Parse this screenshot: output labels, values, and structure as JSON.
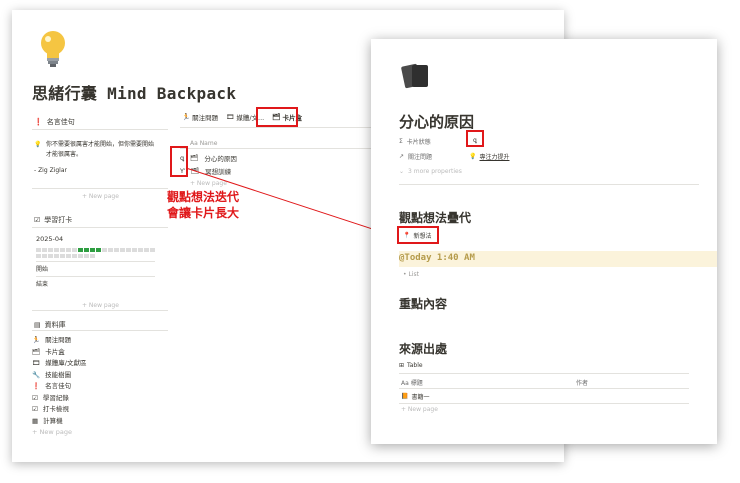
{
  "back_page": {
    "icon": "light-bulb-icon",
    "title": "思緒行囊 Mind Backpack",
    "quote_section": {
      "icon": "exclamation-icon",
      "label": "名言佳句"
    },
    "quote_text": "你不需要很厲害才能開始，但你需要開始才能很厲害。",
    "quote_author": "- Zig Ziglar",
    "new_page_1": "+ New page",
    "checkin_section": {
      "icon": "checkbox-icon",
      "label": "學習打卡"
    },
    "calendar_month": "2025-04",
    "start_label": "開始",
    "end_label": "結束",
    "new_page_2": "+ New page",
    "database_section": {
      "icon": "database-icon",
      "label": "資料庫"
    },
    "sidebar_items": [
      {
        "icon": "running-icon",
        "label": "關注問題"
      },
      {
        "icon": "cards-icon",
        "label": "卡片盒"
      },
      {
        "icon": "film-icon",
        "label": "媒體庫/文獻區"
      },
      {
        "icon": "wrench-icon",
        "label": "技能樹圖"
      },
      {
        "icon": "exclamation-icon",
        "label": "名言佳句"
      },
      {
        "icon": "checkbox-icon",
        "label": "學習紀錄"
      },
      {
        "icon": "checkbox-icon",
        "label": "打卡檢視"
      },
      {
        "icon": "calculator-icon",
        "label": "計算機"
      }
    ],
    "sidebar_new_page": "+ New page",
    "tabs": [
      {
        "icon": "running-icon",
        "label": "關注問題"
      },
      {
        "icon": "film-icon",
        "label": "媒體/文..."
      },
      {
        "icon": "cards-icon",
        "label": "卡片盒"
      }
    ],
    "column_header": "Aa Name",
    "list_items": [
      {
        "label": "分心的原因"
      },
      {
        "label": "冥想訓練"
      }
    ],
    "list_new_page": "+ New page",
    "annotation": "觀點想法迭代\n會讓卡片長大"
  },
  "front_page": {
    "icon": "cards-icon",
    "title": "分心的原因",
    "prop_state_label": "卡片狀態",
    "prop_issue_label": "關注問題",
    "prop_issue_value": "專注力提升",
    "more_props": "3 more properties",
    "heading_iteration": "觀點想法疊代",
    "new_idea_tag": "新想法",
    "code_line": "@Today 1:40 AM",
    "bullet": "List",
    "heading_key": "重點內容",
    "heading_source": "來源出處",
    "table_label": "Table",
    "table_col_1": "Aa 標題",
    "table_col_2": "作者",
    "table_row_1": "書籍一",
    "table_new_page": "+ New page"
  },
  "colors": {
    "accent_red": "#e0181a",
    "check_green": "#2e9e41",
    "code_bg": "#fbf3db"
  }
}
